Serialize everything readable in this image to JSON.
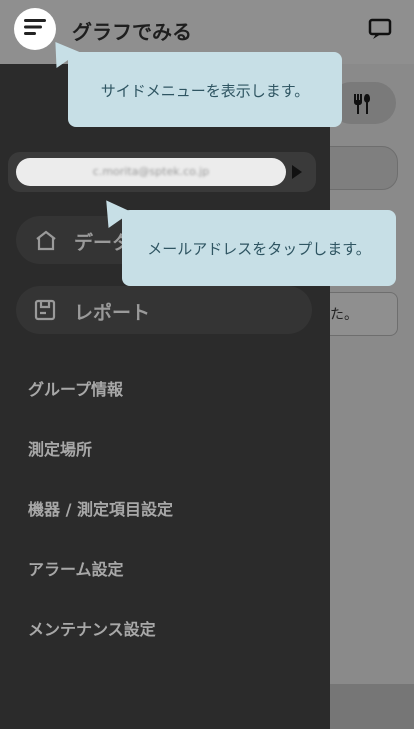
{
  "header": {
    "title": "グラフでみる"
  },
  "drawer": {
    "email": "c.morita@sptek.co.jp",
    "nav": [
      {
        "label": "データ",
        "icon": "home-icon"
      },
      {
        "label": "レポート",
        "icon": "report-icon"
      }
    ],
    "menu": [
      "グループ情報",
      "測定場所",
      "機器 / 測定項目設定",
      "アラーム設定",
      "メンテナンス設定"
    ]
  },
  "tooltips": {
    "menu_tip": "サイドメニューを表示します。",
    "email_tip": "メールアドレスをタップします。"
  },
  "background": {
    "note_fragment": "た。"
  },
  "colors": {
    "tooltip_bg": "#c7dfe6",
    "drawer_bg": "#2b2b2b",
    "tooltip_text": "#2f5562"
  }
}
